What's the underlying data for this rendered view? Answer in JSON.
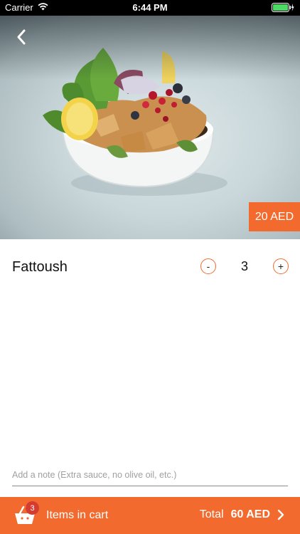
{
  "status_bar": {
    "carrier": "Carrier",
    "time": "6:44 PM"
  },
  "item": {
    "name": "Fattoush",
    "price": "20 AED",
    "quantity": "3",
    "decrement_label": "-",
    "increment_label": "+",
    "image_icon": "fattoush-salad-photo"
  },
  "note": {
    "placeholder": "Add a note (Extra sauce, no olive oil, etc.)"
  },
  "cart": {
    "count": "3",
    "label": "Items in cart",
    "total_label": "Total",
    "total_value": "60 AED"
  },
  "colors": {
    "accent": "#f26a2e",
    "badge": "#d63b2f"
  }
}
